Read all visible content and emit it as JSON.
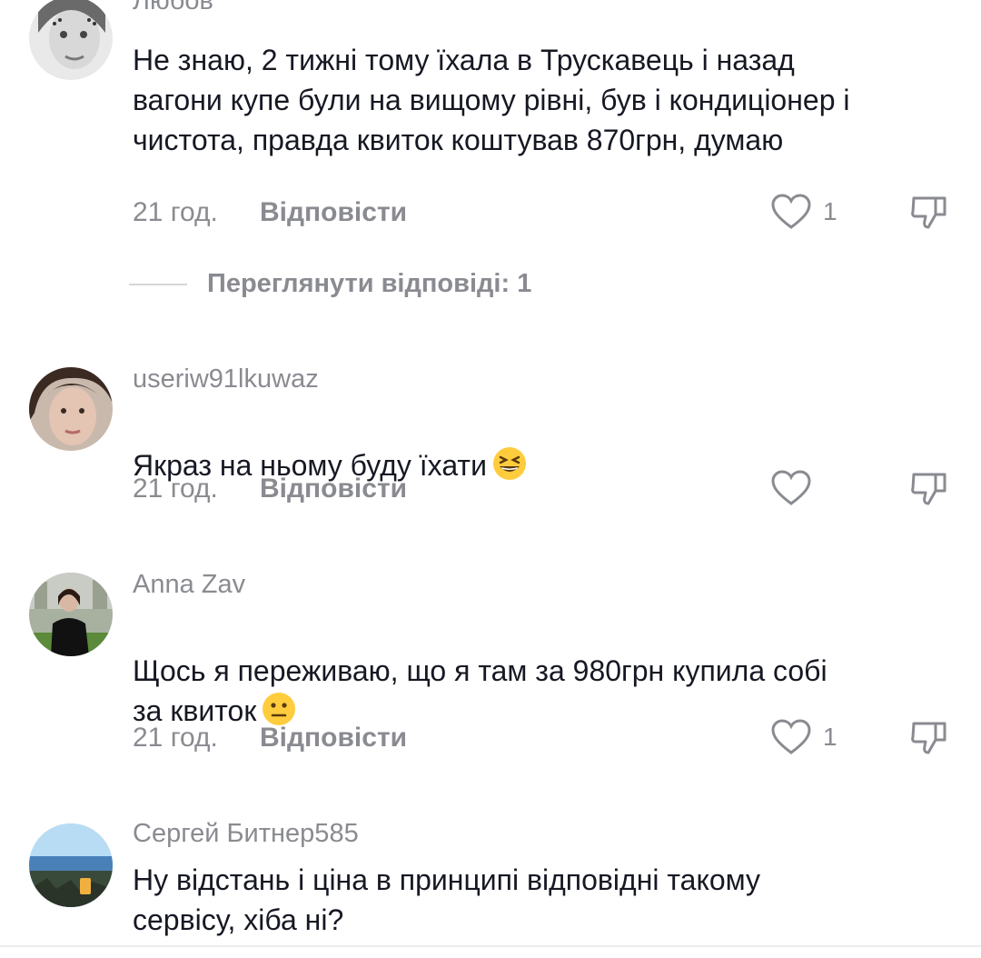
{
  "comments": [
    {
      "username": "Любов",
      "text": "Не знаю, 2 тижні тому їхала в Трускавець і назад\nвагони купе були на вищому рівні, був і кондиціонер і\nчистота, правда квиток коштував 870грн, думаю",
      "time": "21 год.",
      "reply_label": "Відповісти",
      "likes": "1",
      "view_replies": "Переглянути відповіді: 1"
    },
    {
      "username": "useriw91lkuwaz",
      "text": "Якраз на ньому буду їхати",
      "emoji": "grinning-squinting-face",
      "time": "21 год.",
      "reply_label": "Відповісти",
      "likes": ""
    },
    {
      "username": "Anna Zav",
      "text": "Щось я переживаю, що я там за 980грн купила собі\nза квиток",
      "emoji": "neutral-face",
      "time": "21 год.",
      "reply_label": "Відповісти",
      "likes": "1"
    },
    {
      "username": "Сергей Битнер585",
      "text": "Ну відстань і ціна в принципі відповідні такому\nсервісу, хіба ні?"
    }
  ],
  "colors": {
    "text_primary": "#161823",
    "text_secondary": "#8a8b91",
    "background": "#ffffff",
    "emoji_yellow": "#ffcc3d"
  },
  "icons": [
    "heart-outline-icon",
    "dislike-thumb-icon"
  ]
}
